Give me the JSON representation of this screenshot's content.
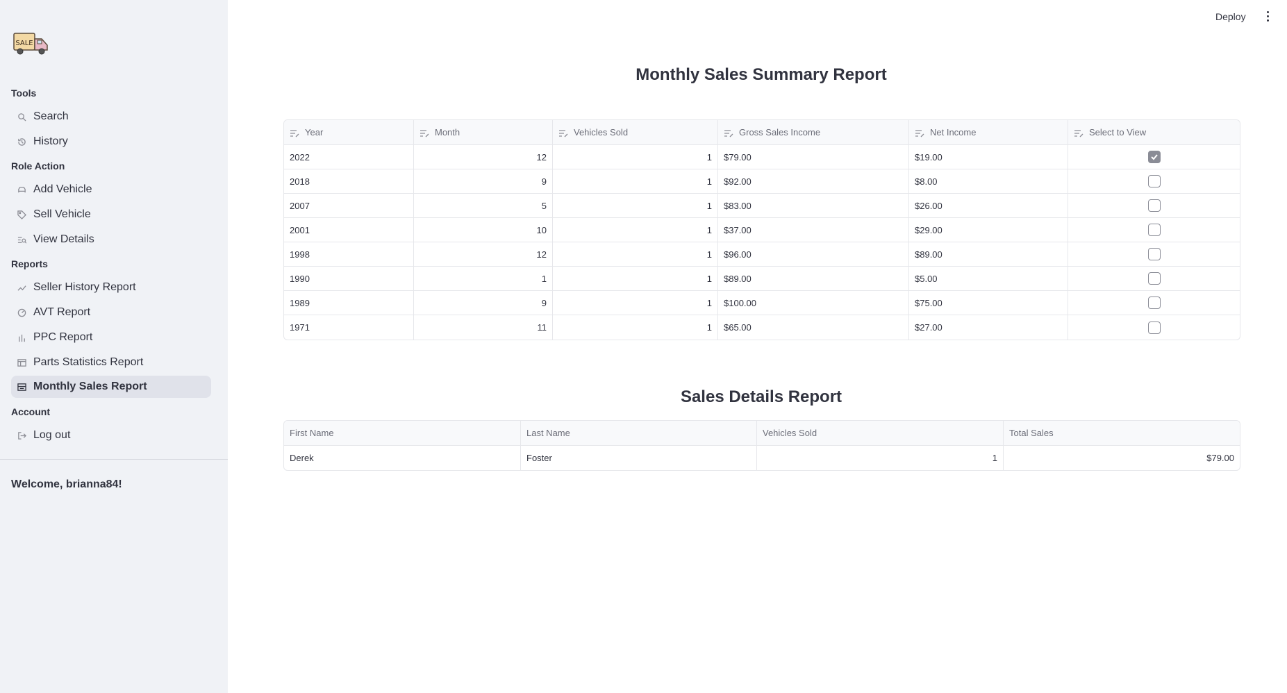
{
  "sidebar": {
    "logo_text": "SALE",
    "sections": {
      "tools": "Tools",
      "role_action": "Role Action",
      "reports": "Reports",
      "account": "Account"
    },
    "items": {
      "search": "Search",
      "history": "History",
      "add_vehicle": "Add Vehicle",
      "sell_vehicle": "Sell Vehicle",
      "view_details": "View Details",
      "seller_history": "Seller History Report",
      "avt": "AVT Report",
      "ppc": "PPC Report",
      "parts_statistics": "Parts Statistics Report",
      "monthly_sales": "Monthly Sales Report",
      "logout": "Log out"
    },
    "active_item": "monthly_sales",
    "welcome": "Welcome, brianna84!"
  },
  "topbar": {
    "deploy": "Deploy"
  },
  "summary": {
    "title": "Monthly Sales Summary Report",
    "columns": [
      "Year",
      "Month",
      "Vehicles Sold",
      "Gross Sales Income",
      "Net Income",
      "Select to View"
    ],
    "rows": [
      {
        "year": "2022",
        "month": "12",
        "vehicles_sold": "1",
        "gross": "$79.00",
        "net": "$19.00",
        "selected": true
      },
      {
        "year": "2018",
        "month": "9",
        "vehicles_sold": "1",
        "gross": "$92.00",
        "net": "$8.00",
        "selected": false
      },
      {
        "year": "2007",
        "month": "5",
        "vehicles_sold": "1",
        "gross": "$83.00",
        "net": "$26.00",
        "selected": false
      },
      {
        "year": "2001",
        "month": "10",
        "vehicles_sold": "1",
        "gross": "$37.00",
        "net": "$29.00",
        "selected": false
      },
      {
        "year": "1998",
        "month": "12",
        "vehicles_sold": "1",
        "gross": "$96.00",
        "net": "$89.00",
        "selected": false
      },
      {
        "year": "1990",
        "month": "1",
        "vehicles_sold": "1",
        "gross": "$89.00",
        "net": "$5.00",
        "selected": false
      },
      {
        "year": "1989",
        "month": "9",
        "vehicles_sold": "1",
        "gross": "$100.00",
        "net": "$75.00",
        "selected": false
      },
      {
        "year": "1971",
        "month": "11",
        "vehicles_sold": "1",
        "gross": "$65.00",
        "net": "$27.00",
        "selected": false
      }
    ]
  },
  "details": {
    "title": "Sales Details Report",
    "columns": [
      "First Name",
      "Last Name",
      "Vehicles Sold",
      "Total Sales"
    ],
    "rows": [
      {
        "first_name": "Derek",
        "last_name": "Foster",
        "vehicles_sold": "1",
        "total_sales": "$79.00"
      }
    ]
  }
}
